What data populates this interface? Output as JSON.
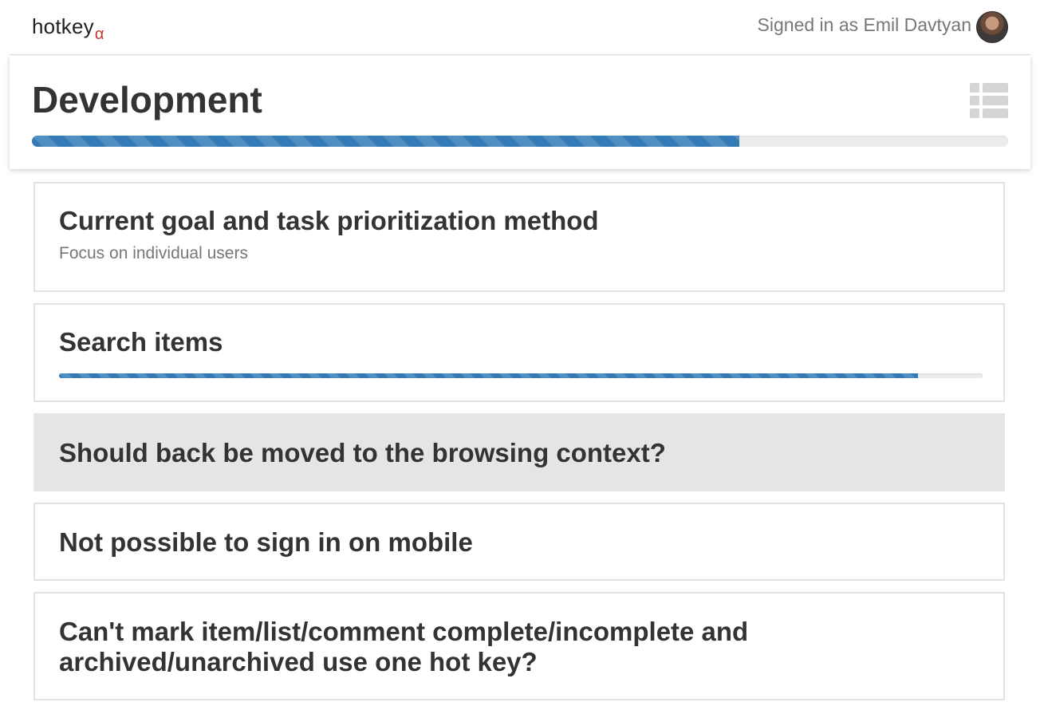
{
  "app": {
    "brand": "hotkey",
    "brand_suffix": "α",
    "brand_suffix_color": "#c0392b",
    "signed_in_text": "Signed in as Emil Davtyan",
    "avatar_icon": "user-avatar"
  },
  "header": {
    "title": "Development",
    "list_view_icon": "list-view-icon",
    "progress_percent": 72.5,
    "progress_color": "#337ab7"
  },
  "items": [
    {
      "title": "Current goal and task prioritization method",
      "subtitle": "Focus on individual users",
      "selected": false
    },
    {
      "title": "Search items",
      "progress_percent": 93,
      "selected": false
    },
    {
      "title": "Should back be moved to the browsing context?",
      "selected": true
    },
    {
      "title": "Not possible to sign in on mobile",
      "selected": false
    },
    {
      "title_line1": "Can't mark item/list/comment complete/incomplete and",
      "title_line2": "archived/unarchived use one hot key?",
      "selected": false
    }
  ]
}
